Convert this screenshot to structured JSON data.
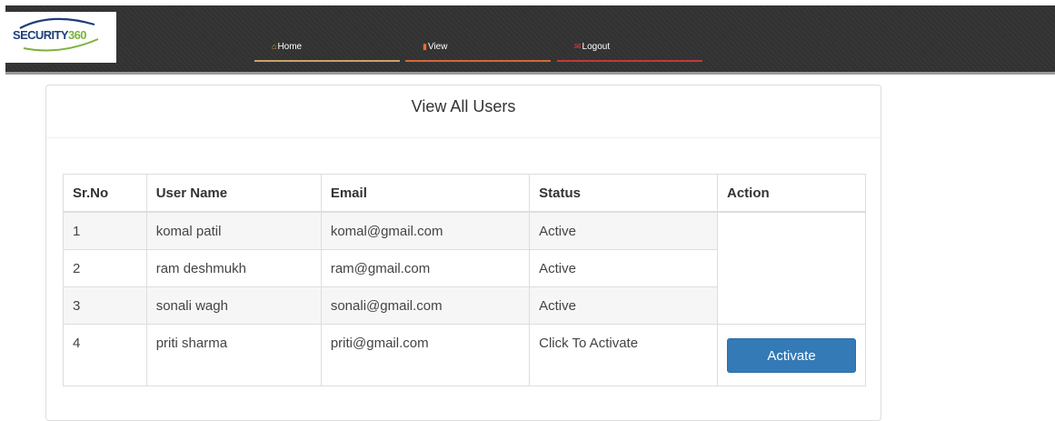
{
  "logo": {
    "part1": "SECURITY",
    "part2": "360"
  },
  "nav": {
    "home": "Home",
    "view": "View",
    "logout": "Logout"
  },
  "panel": {
    "title": "View All Users"
  },
  "table": {
    "headers": [
      "Sr.No",
      "User Name",
      "Email",
      "Status",
      "Action"
    ],
    "rows": [
      {
        "sr": "1",
        "name": "komal patil",
        "email": "komal@gmail.com",
        "status": "Active"
      },
      {
        "sr": "2",
        "name": "ram deshmukh",
        "email": "ram@gmail.com",
        "status": "Active"
      },
      {
        "sr": "3",
        "name": "sonali wagh",
        "email": "sonali@gmail.com",
        "status": "Active"
      },
      {
        "sr": "4",
        "name": "priti sharma",
        "email": "priti@gmail.com",
        "status": "Click To Activate",
        "action": "Activate"
      }
    ]
  },
  "colors": {
    "active": "#2f8a2f",
    "inactive": "#d9342b",
    "button": "#337ab7",
    "topbar": "#323232"
  },
  "icons": {
    "home": "home-icon",
    "view": "flag-icon",
    "logout": "envelope-icon"
  }
}
